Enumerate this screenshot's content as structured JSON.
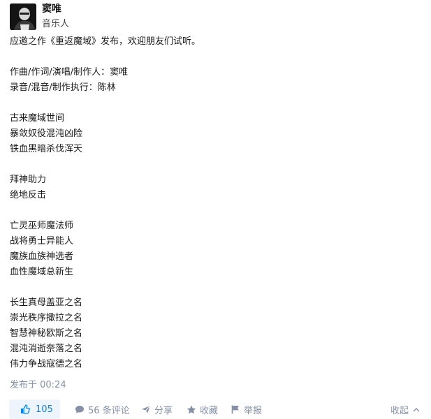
{
  "author": {
    "name": "窦唯",
    "title": "音乐人"
  },
  "post": {
    "lines": [
      "应邀之作《重返魔域》发布，欢迎朋友们试听。",
      "",
      "作曲/作词/演唱/制作人：窦唯",
      "录音/混音/制作执行：陈林",
      "",
      "古来魔域世间",
      "暴敛奴役混沌凶险",
      "铁血黑暗杀伐浑天",
      "",
      "拜神助力",
      "绝地反击",
      "",
      "亡灵巫师魔法师",
      "战将勇士异能人",
      "魔族血族神选者",
      "血性魔域总新生",
      "",
      "长生真母盖亚之名",
      "崇光秩序撒拉之名",
      "智慧神秘欧斯之名",
      "混沌消逝奈落之名",
      "伟力争战寇德之名"
    ],
    "published": "发布于 00:24"
  },
  "actions": {
    "vote_count": "105",
    "comments": "56 条评论",
    "share": "分享",
    "favorite": "收藏",
    "report": "举报",
    "collapse": "收起"
  },
  "colors": {
    "accent": "#0084ff",
    "muted": "#8590a6",
    "vote_bg": "#eef4fc"
  }
}
